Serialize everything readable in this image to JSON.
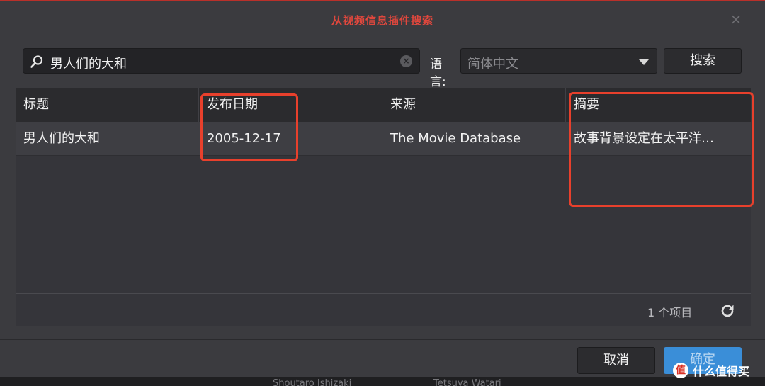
{
  "dialog": {
    "title": "从视频信息插件搜索",
    "close_icon": "×"
  },
  "search": {
    "query": "男人们的大和",
    "clear_icon": "×",
    "language_label": "语言:",
    "language_value": "简体中文",
    "search_button": "搜索"
  },
  "table": {
    "columns": [
      "标题",
      "发布日期",
      "来源",
      "摘要"
    ],
    "rows": [
      [
        "男人们的大和",
        "2005-12-17",
        "The Movie Database",
        "故事背景设定在太平洋…"
      ]
    ]
  },
  "footer": {
    "item_count": "1 个项目"
  },
  "buttons": {
    "cancel": "取消",
    "ok": "确定"
  },
  "background": {
    "text1": "Shoutaro Ishizaki",
    "text2": "Tetsuya Watari"
  },
  "watermark": {
    "badge": "值",
    "text": "什么值得买"
  },
  "colors": {
    "title": "#e0473d",
    "highlight_box": "#e8402c",
    "primary_button": "#3a8ed8"
  }
}
